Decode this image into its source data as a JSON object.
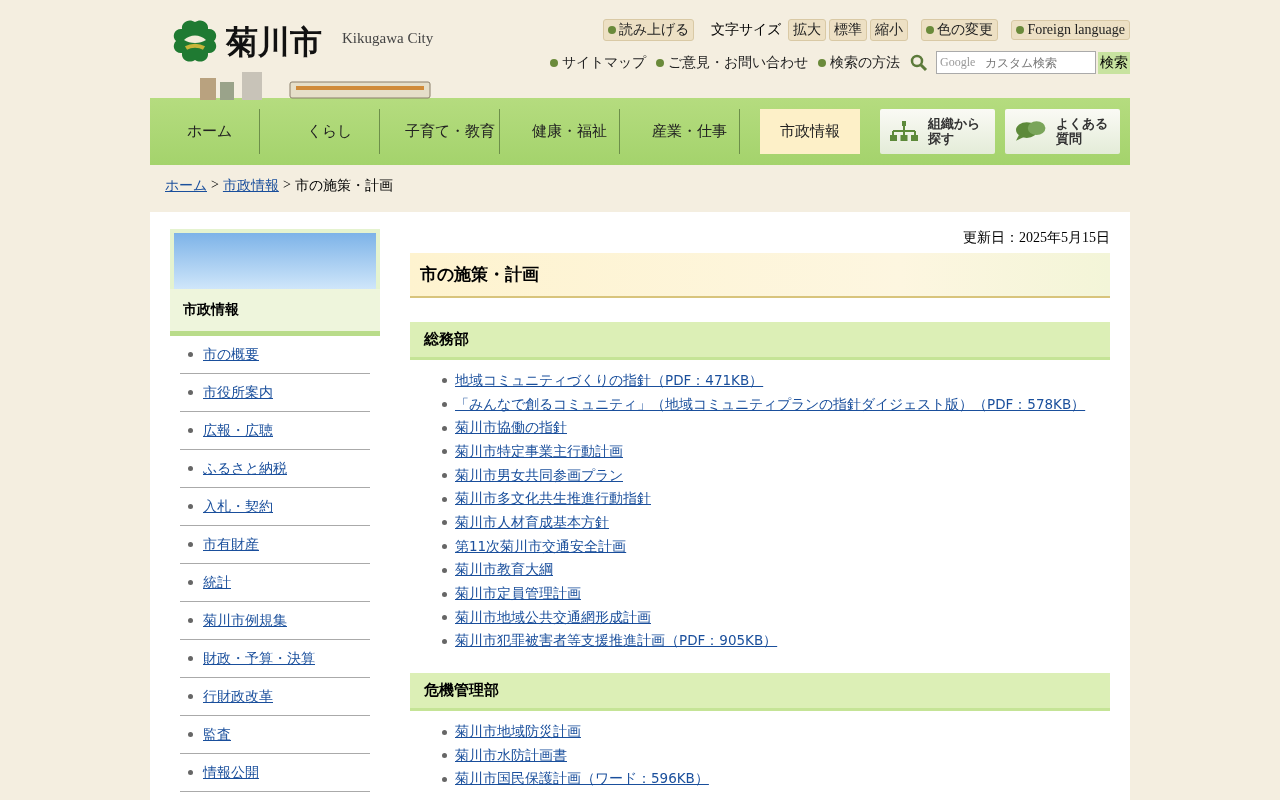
{
  "header": {
    "logo_text": "菊川市",
    "logo_subtitle": "Kikugawa City",
    "tools": [
      {
        "kind": "button",
        "label": "読み上げる"
      },
      {
        "kind": "label",
        "label": "文字サイズ"
      },
      {
        "kind": "size",
        "label": "拡大"
      },
      {
        "kind": "size",
        "label": "標準"
      },
      {
        "kind": "size",
        "label": "縮小"
      },
      {
        "kind": "button",
        "label": "色の変更"
      },
      {
        "kind": "button",
        "label": "Foreign language"
      }
    ],
    "links": [
      "サイトマップ",
      "ご意見・お問い合わせ",
      "検索の方法"
    ],
    "search": {
      "placeholder": "カスタム検索",
      "brand": "Google",
      "button": "検索"
    }
  },
  "nav": [
    {
      "kind": "text",
      "label": "ホーム",
      "selected": false
    },
    {
      "kind": "text",
      "label": "くらし",
      "selected": false
    },
    {
      "kind": "text",
      "label": "子育て・教育",
      "selected": false
    },
    {
      "kind": "text",
      "label": "健康・福祉",
      "selected": false
    },
    {
      "kind": "text",
      "label": "産業・仕事",
      "selected": false
    },
    {
      "kind": "text",
      "label": "市政情報",
      "selected": true
    },
    {
      "kind": "org",
      "label": "組織から探す",
      "selected": false
    },
    {
      "kind": "faq",
      "label": "よくある質問",
      "selected": false
    }
  ],
  "breadcrumb_separator": ">",
  "breadcrumb": [
    {
      "label": "ホーム",
      "link": true
    },
    {
      "label": "市政情報",
      "link": true
    },
    {
      "label": "市の施策・計画",
      "link": false
    }
  ],
  "sidebar": {
    "title": "市政情報",
    "items": [
      "市の概要",
      "市役所案内",
      "広報・広聴",
      "ふるさと納税",
      "入札・契約",
      "市有財産",
      "統計",
      "菊川市例規集",
      "財政・予算・決算",
      "行財政改革",
      "監査",
      "情報公開"
    ]
  },
  "updated": "更新日：2025年5月15日",
  "page_title": "市の施策・計画",
  "sections": [
    {
      "title": "総務部",
      "links": [
        "地域コミュニティづくりの指針（PDF：471KB）",
        "「みんなで創るコミュニティ」（地域コミュニティプランの指針ダイジェスト版）（PDF：578KB）",
        "菊川市協働の指針",
        "菊川市特定事業主行動計画",
        "菊川市男女共同参画プラン",
        "菊川市多文化共生推進行動指針",
        "菊川市人材育成基本方針",
        "第11次菊川市交通安全計画",
        "菊川市教育大綱",
        "菊川市定員管理計画",
        "菊川市地域公共交通網形成計画",
        "菊川市犯罪被害者等支援推進計画（PDF：905KB）"
      ]
    },
    {
      "title": "危機管理部",
      "links": [
        "菊川市地域防災計画",
        "菊川市水防計画書",
        "菊川市国民保護計画（ワード：596KB）"
      ]
    }
  ]
}
